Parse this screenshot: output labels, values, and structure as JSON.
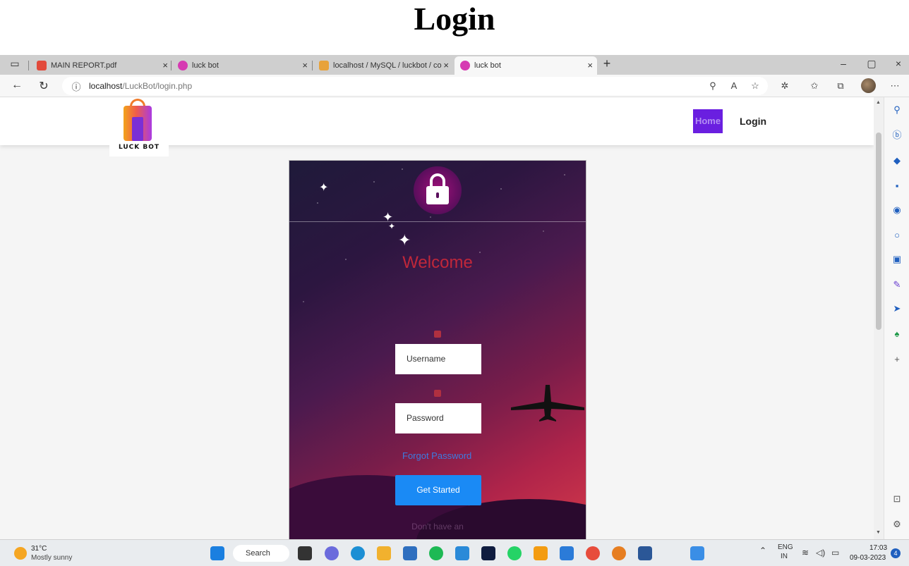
{
  "document": {
    "title": "Login"
  },
  "browser": {
    "tabs": [
      {
        "label": "MAIN REPORT.pdf",
        "active": false
      },
      {
        "label": "luck bot",
        "active": false
      },
      {
        "label": "localhost / MySQL / luckbot / co",
        "active": false
      },
      {
        "label": "luck bot",
        "active": true
      }
    ],
    "new_tab": "+",
    "close_glyph": "×",
    "window_controls": {
      "minimize": "–",
      "maximize": "▢",
      "close": "×"
    },
    "url_host": "localhost",
    "url_path": "/LuckBot/login.php"
  },
  "site": {
    "logo_text": "LUCK BOT",
    "nav": {
      "home": "Home",
      "login": "Login"
    }
  },
  "login": {
    "welcome": "Welcome",
    "username_placeholder": "Username",
    "password_placeholder": "Password",
    "forgot_password": "Forgot Password",
    "submit": "Get Started",
    "footer_text": "Don't have an"
  },
  "taskbar": {
    "weather_temp": "31°C",
    "weather_desc": "Mostly sunny",
    "search": "Search",
    "lang_primary": "ENG",
    "lang_secondary": "IN",
    "time": "17:03",
    "date": "09-03-2023",
    "notifications": "4"
  },
  "colors": {
    "accent_purple": "#6a1fe0",
    "button_blue": "#1a8af5",
    "welcome_red": "#c0273a"
  }
}
